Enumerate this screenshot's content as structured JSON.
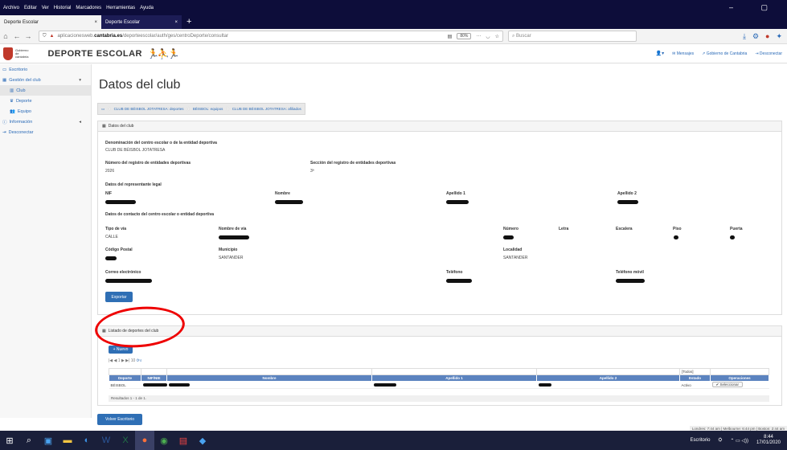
{
  "browser": {
    "menu": [
      "Archivo",
      "Editar",
      "Ver",
      "Historial",
      "Marcadores",
      "Herramientas",
      "Ayuda"
    ],
    "tabs": [
      {
        "label": "Deporte Escolar",
        "close": "×"
      },
      {
        "label": "Deporte Escolar",
        "close": "×"
      }
    ],
    "newtab": "+",
    "url_prefix": "aplicacionesweb.",
    "url_host": "cantabria.es",
    "url_path": "/deporteescolar/auth/ges/centroDeporte/consultar",
    "zoom": "80%",
    "search_placeholder": "Buscar"
  },
  "header": {
    "logo_text": [
      "Gobierno",
      "de",
      "cantabria"
    ],
    "title": "DEPORTE ESCOLAR",
    "nav": [
      "Mensajes",
      "Gobierno de Cantabria",
      "Desconectar"
    ]
  },
  "sidebar": {
    "items": [
      {
        "label": "Escritorio",
        "icon": "monitor-icon"
      },
      {
        "label": "Gestión del club",
        "icon": "table-icon"
      },
      {
        "label": "Club",
        "icon": "building-icon"
      },
      {
        "label": "Deporte",
        "icon": "trophy-icon"
      },
      {
        "label": "Equipo",
        "icon": "users-icon"
      },
      {
        "label": "Información",
        "icon": "info-icon"
      },
      {
        "label": "Desconectar",
        "icon": "logout-icon"
      }
    ]
  },
  "main": {
    "title": "Datos del club",
    "breadcrumb": [
      "CLUB DE BÉISBOL JOTATRESA: deportes",
      "BÉISBOL: equipos",
      "CLUB DE BÉISBOL JOTATRESA: afiliados"
    ],
    "panel1": {
      "title": "Datos del club",
      "denominacion_label": "Denominación del centro escolar o de la entidad deportiva",
      "denominacion_value": "CLUB DE BÉISBOL JOTATRESA",
      "registro_label": "Número del registro de entidades deportivas",
      "registro_value": "2026",
      "seccion_label": "Sección del registro de entidades deportivas",
      "seccion_value": "3ª",
      "representante_label": "Datos del representante legal",
      "nif_label": "NIF",
      "nombre_label": "Nombre",
      "apellido1_label": "Apellido 1",
      "apellido2_label": "Apellido 2",
      "contacto_label": "Datos de contacto del centro escolar o entidad deportiva",
      "tipovia_label": "Tipo de vía",
      "tipovia_value": "CALLE",
      "nombrevia_label": "Nombre de vía",
      "numero_label": "Número",
      "letra_label": "Letra",
      "escalera_label": "Escalera",
      "piso_label": "Piso",
      "puerta_label": "Puerta",
      "cp_label": "Código Postal",
      "municipio_label": "Municipio",
      "municipio_value": "SANTANDER",
      "localidad_label": "Localidad",
      "localidad_value": "SANTANDER",
      "correo_label": "Correo electrónico",
      "telefono_label": "Teléfono",
      "movil_label": "Teléfono móvil",
      "export_button": "Exportar"
    },
    "panel2": {
      "title": "Listado de deportes del club",
      "new_button": "+ Nuevo",
      "pager": "|◀ ◀ 1 ▶ ▶| 10",
      "filter_state": "[Todos]",
      "columns": [
        "Deporte",
        "NIF/NIE",
        "Nombre",
        "Apellido 1",
        "Apellido 2",
        "Estado",
        "Operaciones"
      ],
      "rows": [
        {
          "deporte": "BÉISBOL",
          "estado": "Activo",
          "op": "✔ Seleccionar"
        }
      ],
      "results": "Resultados 1 - 1 de 1."
    },
    "back_button": "Volver Escritorio"
  },
  "status": {
    "clocks": "Londres: 7:44 am | Melbourne: 6:44 pm | Boston: 2:44 am"
  },
  "taskbar": {
    "desktop": "Escritorio",
    "time": "8:44",
    "date": "17/01/2020"
  }
}
